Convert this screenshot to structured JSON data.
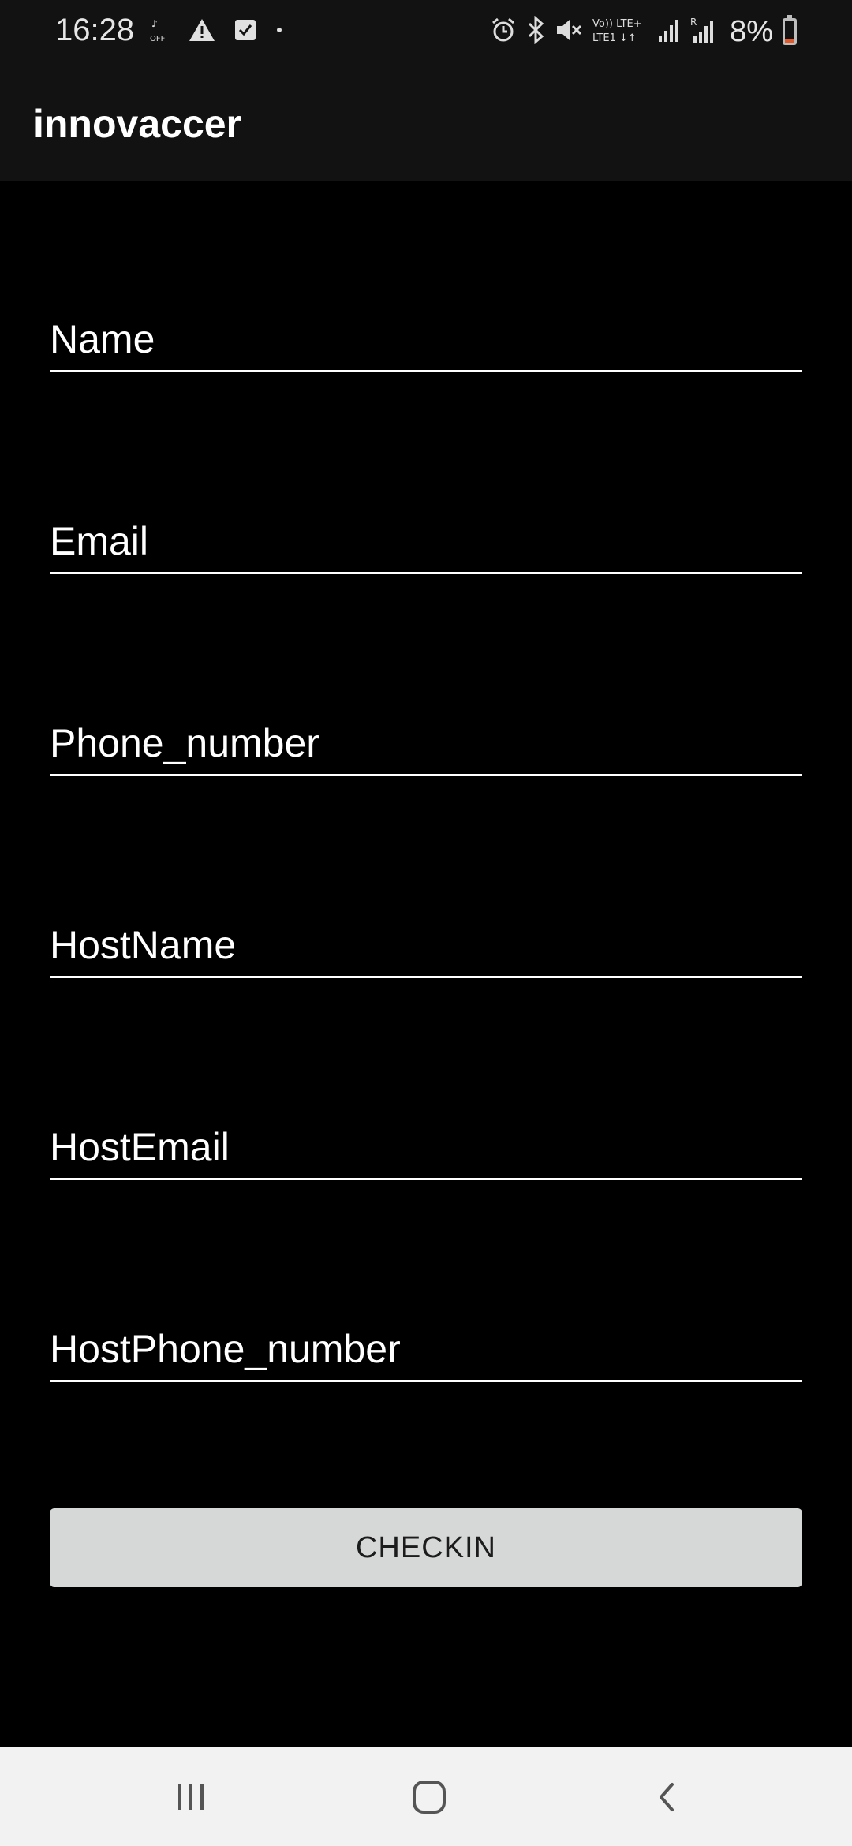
{
  "status_bar": {
    "time": "16:28",
    "battery_percent": "8%",
    "battery_level": 0.08,
    "battery_color": "#e05a2b",
    "left_icons": [
      "wifi-calling-off-icon",
      "warning-icon",
      "checkbox-icon",
      "dot-icon"
    ],
    "right_icons": [
      "alarm-icon",
      "bluetooth-icon",
      "mute-icon",
      "volte-icon",
      "signal-icon",
      "roaming-signal-icon",
      "battery-icon"
    ],
    "volte_label": "Vo)) LTE+ LTE1"
  },
  "app_bar": {
    "title": "innovaccer"
  },
  "form": {
    "fields": [
      {
        "placeholder": "Name",
        "value": ""
      },
      {
        "placeholder": "Email",
        "value": ""
      },
      {
        "placeholder": "Phone_number",
        "value": ""
      },
      {
        "placeholder": "HostName",
        "value": ""
      },
      {
        "placeholder": "HostEmail",
        "value": ""
      },
      {
        "placeholder": "HostPhone_number",
        "value": ""
      }
    ],
    "submit_label": "CHECKIN"
  },
  "nav_bar": {
    "buttons": [
      "recent-apps-icon",
      "home-icon",
      "back-icon"
    ]
  }
}
